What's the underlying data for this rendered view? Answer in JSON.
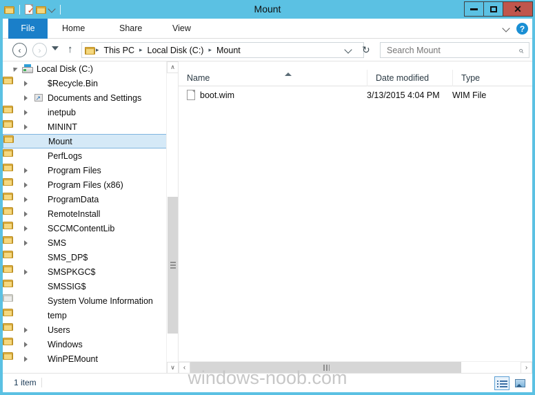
{
  "window": {
    "title": "Mount",
    "controls": {
      "minimize": "minimize-button",
      "maximize": "maximize-button",
      "close": "✕"
    },
    "accent_color": "#5bc1e3",
    "close_color": "#c0564c"
  },
  "quick_access": {
    "items": [
      {
        "name": "explorer-folder-icon",
        "label": ""
      },
      {
        "name": "properties-icon",
        "label": ""
      },
      {
        "name": "new-folder-icon",
        "label": ""
      },
      {
        "name": "customize-qat-dropdown",
        "label": ""
      }
    ]
  },
  "ribbon": {
    "tabs": [
      {
        "label": "File",
        "active": true
      },
      {
        "label": "Home",
        "active": false
      },
      {
        "label": "Share",
        "active": false
      },
      {
        "label": "View",
        "active": false
      }
    ],
    "file_tab_color": "#1a7fc9",
    "expand_icon": "chevron-down-icon",
    "help_label": "?"
  },
  "address_bar": {
    "back": "‹",
    "forward": "›",
    "up": "↑",
    "refresh": "↻",
    "breadcrumbs": [
      "This PC",
      "Local Disk (C:)",
      "Mount"
    ],
    "separator": "▸"
  },
  "search": {
    "placeholder": "Search Mount",
    "value": "",
    "icon": "search-icon"
  },
  "nav_pane": {
    "items": [
      {
        "label": "Local Disk (C:)",
        "icon": "drive",
        "expander": "open",
        "indent": 0,
        "selected": false
      },
      {
        "label": "$Recycle.Bin",
        "icon": "folder",
        "expander": "collapsed",
        "indent": 1,
        "selected": false
      },
      {
        "label": "Documents and Settings",
        "icon": "shortcut",
        "expander": "collapsed",
        "indent": 1,
        "selected": false
      },
      {
        "label": "inetpub",
        "icon": "folder",
        "expander": "collapsed",
        "indent": 1,
        "selected": false
      },
      {
        "label": "MININT",
        "icon": "folder",
        "expander": "collapsed",
        "indent": 1,
        "selected": false
      },
      {
        "label": "Mount",
        "icon": "folder",
        "expander": "none",
        "indent": 1,
        "selected": true
      },
      {
        "label": "PerfLogs",
        "icon": "folder",
        "expander": "none",
        "indent": 1,
        "selected": false
      },
      {
        "label": "Program Files",
        "icon": "folder",
        "expander": "collapsed",
        "indent": 1,
        "selected": false
      },
      {
        "label": "Program Files (x86)",
        "icon": "folder",
        "expander": "collapsed",
        "indent": 1,
        "selected": false
      },
      {
        "label": "ProgramData",
        "icon": "folder",
        "expander": "collapsed",
        "indent": 1,
        "selected": false
      },
      {
        "label": "RemoteInstall",
        "icon": "folder",
        "expander": "collapsed",
        "indent": 1,
        "selected": false
      },
      {
        "label": "SCCMContentLib",
        "icon": "folder",
        "expander": "collapsed",
        "indent": 1,
        "selected": false
      },
      {
        "label": "SMS",
        "icon": "folder",
        "expander": "collapsed",
        "indent": 1,
        "selected": false
      },
      {
        "label": "SMS_DP$",
        "icon": "folder",
        "expander": "none",
        "indent": 1,
        "selected": false
      },
      {
        "label": "SMSPKGC$",
        "icon": "folder",
        "expander": "collapsed",
        "indent": 1,
        "selected": false
      },
      {
        "label": "SMSSIG$",
        "icon": "folder",
        "expander": "none",
        "indent": 1,
        "selected": false
      },
      {
        "label": "System Volume Information",
        "icon": "folder-grey",
        "expander": "none",
        "indent": 1,
        "selected": false
      },
      {
        "label": "temp",
        "icon": "folder",
        "expander": "none",
        "indent": 1,
        "selected": false
      },
      {
        "label": "Users",
        "icon": "folder",
        "expander": "collapsed",
        "indent": 1,
        "selected": false
      },
      {
        "label": "Windows",
        "icon": "folder",
        "expander": "collapsed",
        "indent": 1,
        "selected": false
      },
      {
        "label": "WinPEMount",
        "icon": "folder",
        "expander": "collapsed",
        "indent": 1,
        "selected": false
      }
    ],
    "scroll": {
      "up": "∧",
      "down": "∨"
    }
  },
  "file_list": {
    "columns": [
      "Name",
      "Date modified",
      "Type"
    ],
    "sorted_by": "Name",
    "sort_direction": "ascending",
    "rows": [
      {
        "name": "boot.wim",
        "date_modified": "3/13/2015 4:04 PM",
        "type": "WIM File",
        "icon": "file"
      }
    ],
    "hscroll": {
      "left": "‹",
      "right": "›"
    }
  },
  "status_bar": {
    "item_count": "1 item",
    "watermark": "windows-noob.com",
    "view_buttons": [
      {
        "name": "details-view-button",
        "active": true
      },
      {
        "name": "large-icons-view-button",
        "active": false
      }
    ]
  }
}
